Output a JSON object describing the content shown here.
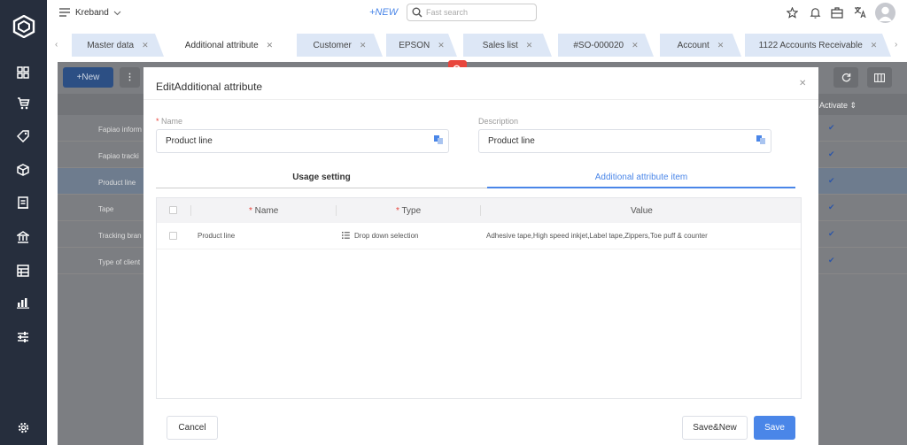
{
  "app": {
    "workspace_name": "Kreband",
    "new_label": "+NEW",
    "search_placeholder": "Fast search"
  },
  "tabs": [
    {
      "label": "Master data",
      "active": false
    },
    {
      "label": "Additional attribute",
      "active": true
    },
    {
      "label": "Customer",
      "active": false
    },
    {
      "label": "EPSON",
      "active": false
    },
    {
      "label": "Sales list",
      "active": false
    },
    {
      "label": "#SO-000020",
      "active": false
    },
    {
      "label": "Account",
      "active": false
    },
    {
      "label": "1122 Accounts Receivable",
      "active": false
    }
  ],
  "background": {
    "new_button": "+New",
    "activate_header": "Activate",
    "rows": [
      "Fapiao inform",
      "Fapiao tracki",
      "Product line",
      "Tape",
      "Tracking bran",
      "Type of client"
    ]
  },
  "modal": {
    "title": "EditAdditional attribute",
    "name_label": "Name",
    "name_value": "Product line",
    "description_label": "Description",
    "description_value": "Product line",
    "subtabs": [
      {
        "label": "Usage setting",
        "active": false
      },
      {
        "label": "Additional attribute item",
        "active": true
      }
    ],
    "table": {
      "headers": {
        "name": "Name",
        "type": "Type",
        "value": "Value"
      },
      "rows": [
        {
          "name": "Product line",
          "type": "Drop down selection",
          "value": "Adhesive tape,High speed inkjet,Label tape,Zippers,Toe puff & counter"
        }
      ]
    },
    "buttons": {
      "cancel": "Cancel",
      "save_new": "Save&New",
      "save": "Save"
    }
  },
  "colors": {
    "sidebar": "#262e3d",
    "accent": "#4a86e8",
    "overlay": "#7c7e82",
    "required": "#e8453c",
    "tab_bg": "#dde7f6"
  }
}
